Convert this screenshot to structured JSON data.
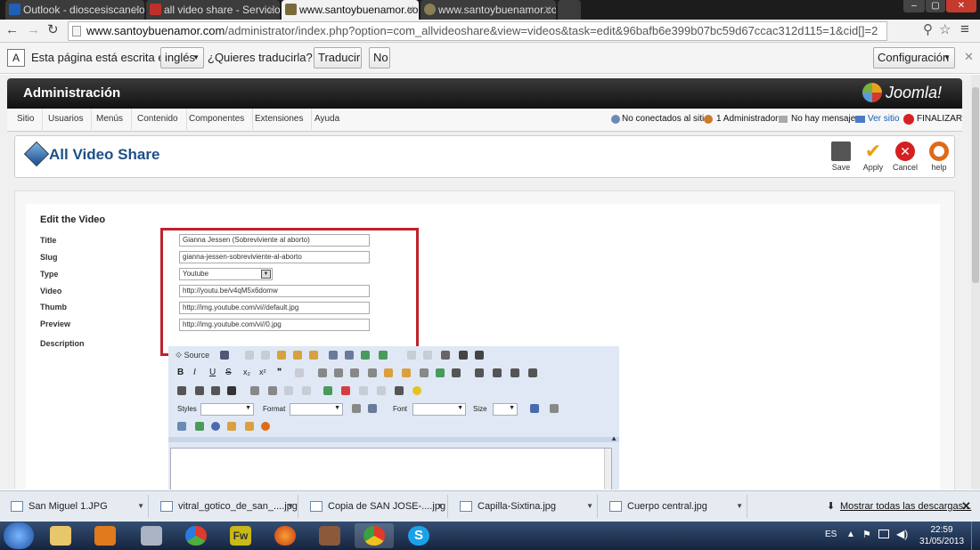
{
  "browser": {
    "tabs": [
      {
        "title": "Outlook - dioscesiscanelo",
        "color": "#1f5fb4"
      },
      {
        "title": "all video share - Servicios",
        "color": "#c0302a"
      },
      {
        "title": "www.santoybuenamor.co",
        "color": "#7a6a3a"
      },
      {
        "title": "www.santoybuenamor.co",
        "color": "#8a7f54"
      }
    ],
    "url_host": "www.santoybuenamor.com",
    "url_path": "/administrator/index.php?option=com_allvideoshare&view=videos&task=edit&96bafb6e399b07bc59d67ccac312d115=1&cid[]=2"
  },
  "translate_bar": {
    "text": "Esta página está escrita en",
    "language": "inglés",
    "question": "¿Quieres traducirla?",
    "translate_button": "Traducir",
    "no_button": "No",
    "config_button": "Configuración"
  },
  "joomla": {
    "admin_title": "Administración",
    "logo_text": "Joomla!",
    "menu": [
      "Sitio",
      "Usuarios",
      "Menús",
      "Contenido",
      "Componentes",
      "Extensiones",
      "Ayuda"
    ],
    "status": {
      "offline": "No conectados al sitio",
      "admins": "1 Administrador",
      "messages": "No hay mensajes",
      "view_site": "Ver sitio",
      "logout": "FINALIZAR"
    },
    "component_title": "All Video Share",
    "toolbar": {
      "save": "Save",
      "apply": "Apply",
      "cancel": "Cancel",
      "help": "help"
    }
  },
  "form": {
    "heading": "Edit the Video",
    "fields": {
      "title": {
        "label": "Title",
        "value": "Gianna Jessen (Sobreviviente al aborto)"
      },
      "slug": {
        "label": "Slug",
        "value": "gianna-jessen-sobreviviente-al-aborto"
      },
      "type": {
        "label": "Type",
        "value": "Youtube"
      },
      "video": {
        "label": "Video",
        "value": "http://youtu.be/v4qM5x6domw"
      },
      "thumb": {
        "label": "Thumb",
        "value": "http://img.youtube.com/vi//default.jpg"
      },
      "preview": {
        "label": "Preview",
        "value": "http://img.youtube.com/vi//0.jpg"
      }
    },
    "description_label": "Description",
    "editor": {
      "source": "Source",
      "styles": "Styles",
      "format": "Format",
      "font": "Font",
      "size": "Size"
    }
  },
  "downloads": {
    "items": [
      "San Miguel 1.JPG",
      "vitral_gotico_de_san_....jpg",
      "Copia de SAN JOSE-....jpg",
      "Capilla-Sixtina.jpg",
      "Cuerpo central.jpg"
    ],
    "show_all": "Mostrar todas las descargas..."
  },
  "taskbar": {
    "lang": "ES",
    "time": "22:59",
    "date": "31/05/2013"
  }
}
